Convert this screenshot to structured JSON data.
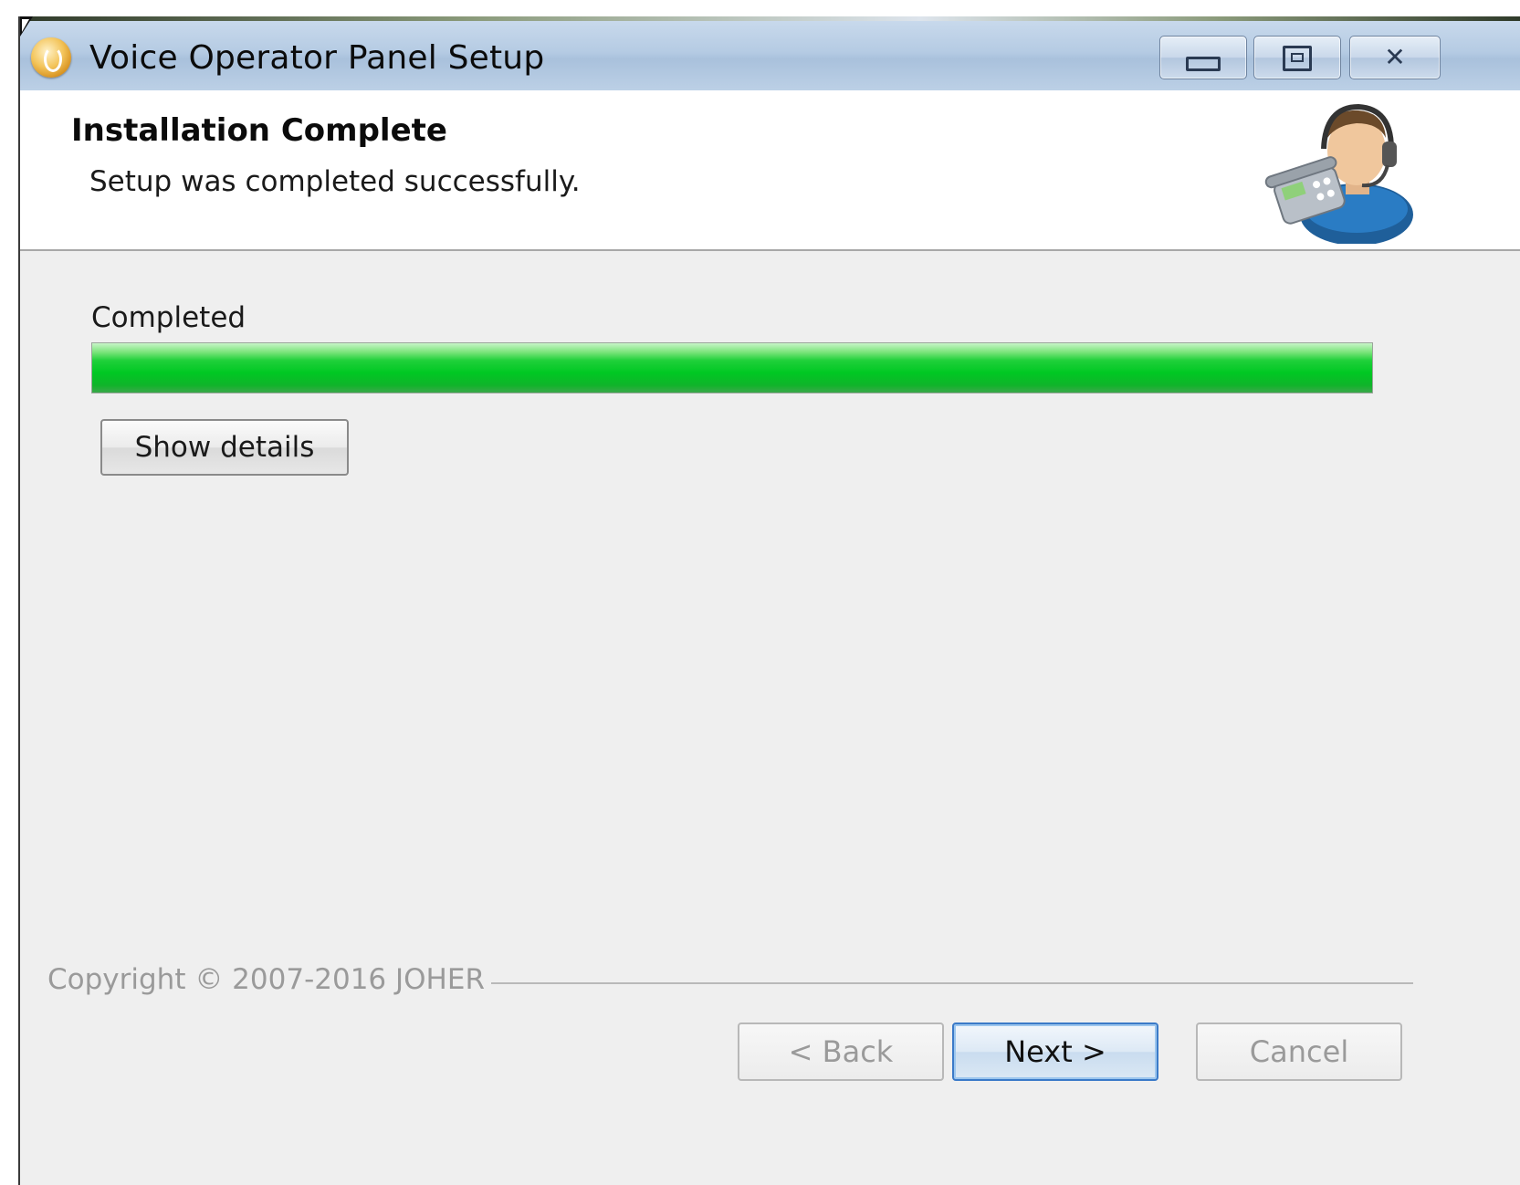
{
  "window": {
    "title": "Voice Operator Panel Setup",
    "controls": {
      "minimize": "minimize-icon",
      "maximize": "maximize-icon",
      "close": "close-icon"
    }
  },
  "header": {
    "title": "Installation Complete",
    "subtitle": "Setup was completed successfully.",
    "icon": "operator-headset-icon"
  },
  "progress": {
    "status_label": "Completed",
    "percent": 100,
    "color": "#00c823"
  },
  "buttons": {
    "show_details": "Show details",
    "back": "< Back",
    "next": "Next >",
    "cancel": "Cancel"
  },
  "footer": {
    "copyright": "Copyright © 2007-2016 JOHER"
  }
}
